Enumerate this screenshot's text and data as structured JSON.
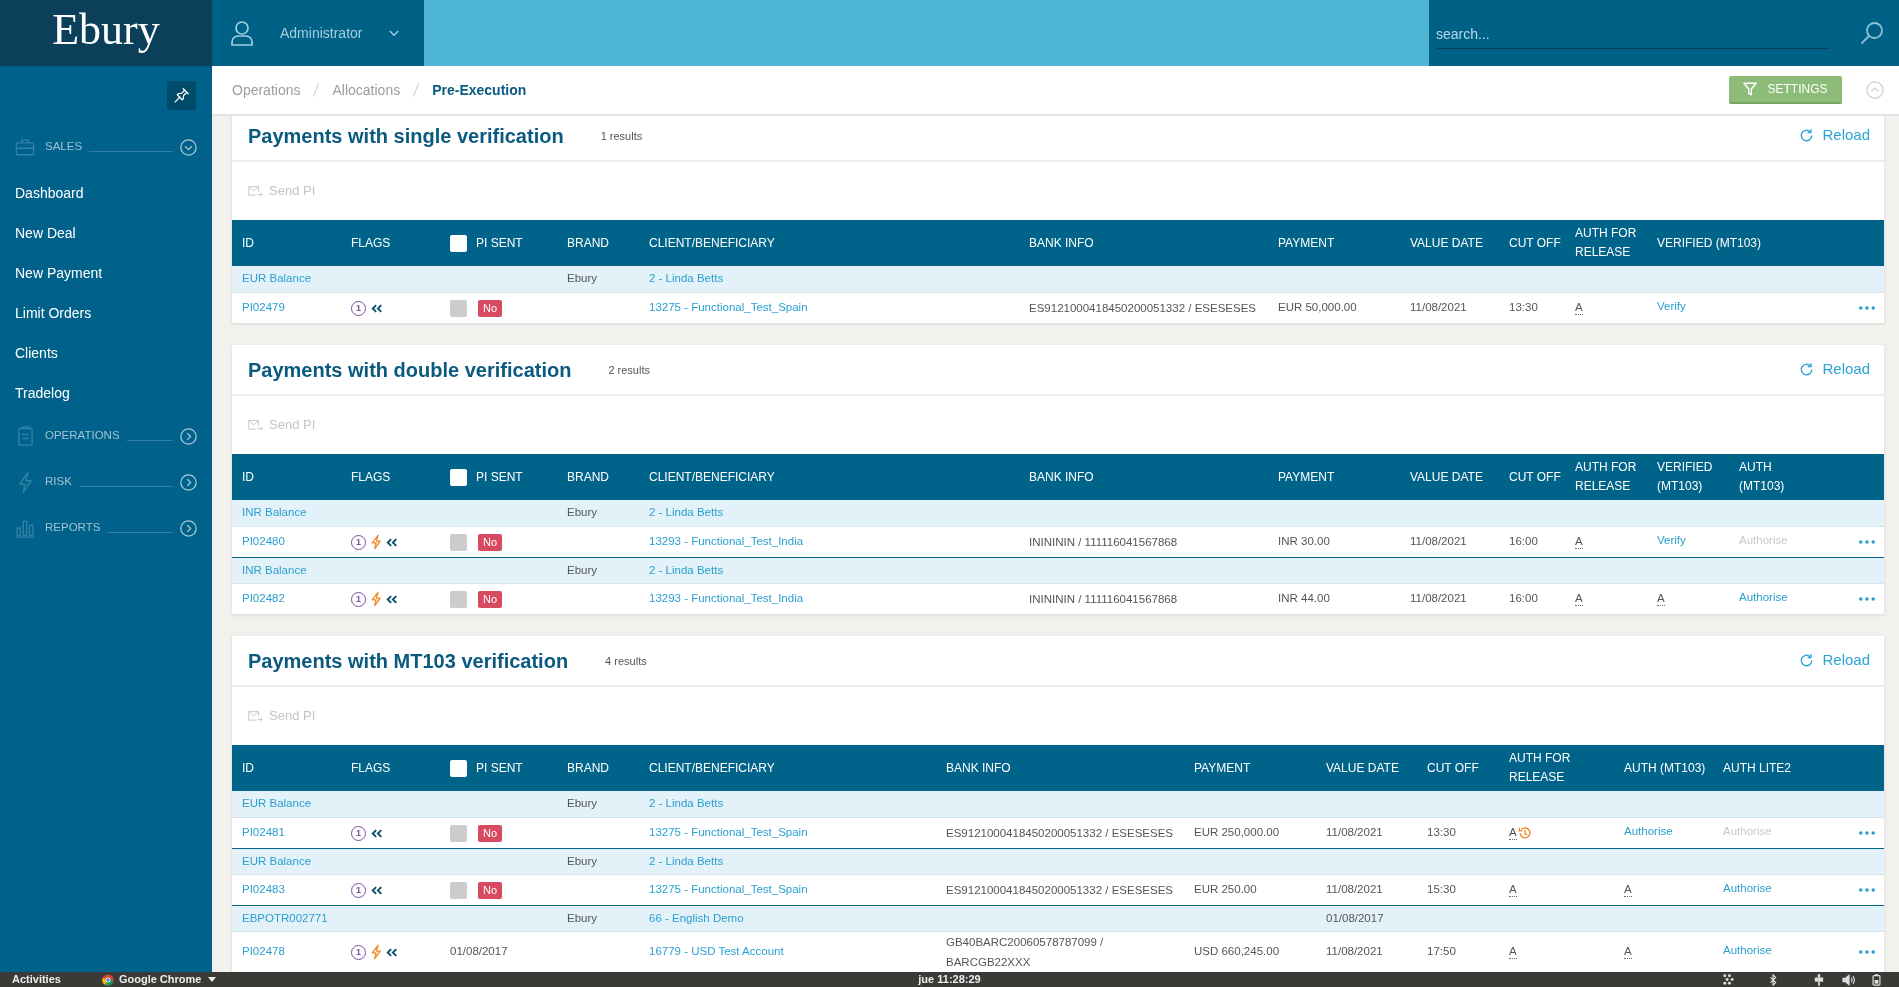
{
  "header": {
    "logo": "Ebury",
    "user_menu": {
      "label": "Administrator"
    },
    "search": {
      "placeholder": "search..."
    }
  },
  "sidebar": {
    "items": [
      {
        "kind": "section",
        "label": "SALES",
        "expanded": true
      },
      {
        "kind": "link",
        "label": "Dashboard"
      },
      {
        "kind": "link",
        "label": "New Deal"
      },
      {
        "kind": "link",
        "label": "New Payment"
      },
      {
        "kind": "link",
        "label": "Limit Orders"
      },
      {
        "kind": "link",
        "label": "Clients"
      },
      {
        "kind": "link",
        "label": "Tradelog"
      },
      {
        "kind": "section",
        "label": "OPERATIONS",
        "expanded": false
      },
      {
        "kind": "section",
        "label": "RISK",
        "expanded": false
      },
      {
        "kind": "section",
        "label": "REPORTS",
        "expanded": false
      }
    ]
  },
  "breadcrumb": [
    {
      "label": "Operations",
      "current": false
    },
    {
      "label": "Allocations",
      "current": false
    },
    {
      "label": "Pre-Execution",
      "current": true
    }
  ],
  "settings_button": {
    "label": "SETTINGS"
  },
  "panels": [
    {
      "title": "Payments with single verification",
      "count": "1 results",
      "reload": "Reload",
      "send_pi": {
        "label": "Send PI",
        "disabled": true
      },
      "table": {
        "columns": [
          {
            "label": "ID"
          },
          {
            "label": "FLAGS"
          },
          {
            "label": "PI SENT",
            "checkbox": {
              "checked": false
            }
          },
          {
            "label": "BRAND"
          },
          {
            "label": "CLIENT/BENEFICIARY"
          },
          {
            "label": "BANK INFO"
          },
          {
            "label": "PAYMENT"
          },
          {
            "label": "VALUE DATE"
          },
          {
            "label": "CUT OFF"
          },
          {
            "label": "AUTH FOR RELEASE"
          },
          {
            "label": "VERIFIED (MT103)"
          }
        ],
        "groups": [
          {
            "account": "EUR Balance",
            "brand": "Ebury",
            "client": "2 - Linda Betts",
            "payment": {
              "id": "PI02479",
              "flags": [
                {
                  "kind": "number",
                  "text": "1"
                },
                {
                  "kind": "chevrons"
                }
              ],
              "pi_sent": {
                "kind": "status",
                "checked": false,
                "disabled": true,
                "label": "No"
              },
              "beneficiary": "13275 - Functional_Test_Spain",
              "bank_info": "ES9121000418450200051332 / ESESESES",
              "amount": "EUR 50,000.00",
              "value_date": "11/08/2021",
              "cut_off": "13:30",
              "auth": [
                {
                  "kind": "initial",
                  "text": "A",
                  "pending": false
                },
                {
                  "kind": "action",
                  "text": "Verify",
                  "disabled": false
                }
              ]
            }
          }
        ]
      }
    },
    {
      "title": "Payments with double verification",
      "count": "2 results",
      "reload": "Reload",
      "send_pi": {
        "label": "Send PI",
        "disabled": true
      },
      "table": {
        "columns": [
          {
            "label": "ID"
          },
          {
            "label": "FLAGS"
          },
          {
            "label": "PI SENT",
            "checkbox": {
              "checked": false
            }
          },
          {
            "label": "BRAND"
          },
          {
            "label": "CLIENT/BENEFICIARY"
          },
          {
            "label": "BANK INFO"
          },
          {
            "label": "PAYMENT"
          },
          {
            "label": "VALUE DATE"
          },
          {
            "label": "CUT OFF"
          },
          {
            "label": "AUTH FOR RELEASE"
          },
          {
            "label": "VERIFIED (MT103)"
          },
          {
            "label": "AUTH (MT103)"
          }
        ],
        "groups": [
          {
            "account": "INR Balance",
            "brand": "Ebury",
            "client": "2 - Linda Betts",
            "payment": {
              "id": "PI02480",
              "flags": [
                {
                  "kind": "number",
                  "text": "1"
                },
                {
                  "kind": "bolt"
                },
                {
                  "kind": "chevrons"
                }
              ],
              "pi_sent": {
                "kind": "status",
                "checked": false,
                "disabled": true,
                "label": "No"
              },
              "beneficiary": "13293 - Functional_Test_India",
              "bank_info": "ININININ / 111116041567868",
              "amount": "INR 30.00",
              "value_date": "11/08/2021",
              "cut_off": "16:00",
              "auth": [
                {
                  "kind": "initial",
                  "text": "A",
                  "pending": false
                },
                {
                  "kind": "action",
                  "text": "Verify",
                  "disabled": false
                },
                {
                  "kind": "action",
                  "text": "Authorise",
                  "disabled": true
                }
              ]
            }
          },
          {
            "account": "INR Balance",
            "brand": "Ebury",
            "client": "2 - Linda Betts",
            "payment": {
              "id": "PI02482",
              "flags": [
                {
                  "kind": "number",
                  "text": "1"
                },
                {
                  "kind": "bolt"
                },
                {
                  "kind": "chevrons"
                }
              ],
              "pi_sent": {
                "kind": "status",
                "checked": false,
                "disabled": true,
                "label": "No"
              },
              "beneficiary": "13293 - Functional_Test_India",
              "bank_info": "ININININ / 111116041567868",
              "amount": "INR 44.00",
              "value_date": "11/08/2021",
              "cut_off": "16:00",
              "auth": [
                {
                  "kind": "initial",
                  "text": "A",
                  "pending": false
                },
                {
                  "kind": "initial",
                  "text": "A",
                  "pending": false
                },
                {
                  "kind": "action",
                  "text": "Authorise",
                  "disabled": false
                }
              ]
            }
          }
        ]
      }
    },
    {
      "title": "Payments with MT103 verification",
      "count": "4 results",
      "reload": "Reload",
      "send_pi": {
        "label": "Send PI",
        "disabled": true
      },
      "table": {
        "columns": [
          {
            "label": "ID"
          },
          {
            "label": "FLAGS"
          },
          {
            "label": "PI SENT",
            "checkbox": {
              "checked": false
            }
          },
          {
            "label": "BRAND"
          },
          {
            "label": "CLIENT/BENEFICIARY"
          },
          {
            "label": "BANK INFO"
          },
          {
            "label": "PAYMENT"
          },
          {
            "label": "VALUE DATE"
          },
          {
            "label": "CUT OFF"
          },
          {
            "label": "AUTH FOR RELEASE"
          },
          {
            "label": "AUTH (MT103)"
          },
          {
            "label": "AUTH LITE2"
          }
        ],
        "groups": [
          {
            "account": "EUR Balance",
            "brand": "Ebury",
            "client": "2 - Linda Betts",
            "payment": {
              "id": "PI02481",
              "flags": [
                {
                  "kind": "number",
                  "text": "1"
                },
                {
                  "kind": "chevrons"
                }
              ],
              "pi_sent": {
                "kind": "status",
                "checked": false,
                "disabled": true,
                "label": "No"
              },
              "beneficiary": "13275 - Functional_Test_Spain",
              "bank_info": "ES9121000418450200051332 / ESESESES",
              "amount": "EUR 250,000.00",
              "value_date": "11/08/2021",
              "cut_off": "13:30",
              "auth": [
                {
                  "kind": "initial",
                  "text": "A",
                  "pending": true
                },
                {
                  "kind": "action",
                  "text": "Authorise",
                  "disabled": false
                },
                {
                  "kind": "action",
                  "text": "Authorise",
                  "disabled": true
                }
              ]
            }
          },
          {
            "account": "EUR Balance",
            "brand": "Ebury",
            "client": "2 - Linda Betts",
            "payment": {
              "id": "PI02483",
              "flags": [
                {
                  "kind": "number",
                  "text": "1"
                },
                {
                  "kind": "chevrons"
                }
              ],
              "pi_sent": {
                "kind": "status",
                "checked": false,
                "disabled": true,
                "label": "No"
              },
              "beneficiary": "13275 - Functional_Test_Spain",
              "bank_info": "ES9121000418450200051332 / ESESESES",
              "amount": "EUR 250.00",
              "value_date": "11/08/2021",
              "cut_off": "15:30",
              "auth": [
                {
                  "kind": "initial",
                  "text": "A",
                  "pending": false
                },
                {
                  "kind": "initial",
                  "text": "A",
                  "pending": false
                },
                {
                  "kind": "action",
                  "text": "Authorise",
                  "disabled": false
                }
              ]
            }
          },
          {
            "account": "EBPOTR002771",
            "brand": "Ebury",
            "client": "66 - English Demo",
            "value_date": "01/08/2017",
            "payment": {
              "id": "PI02478",
              "flags": [
                {
                  "kind": "number",
                  "text": "1"
                },
                {
                  "kind": "bolt"
                },
                {
                  "kind": "chevrons"
                }
              ],
              "pi_sent": {
                "kind": "date",
                "text": "01/08/2017"
              },
              "beneficiary": "16779 - USD Test Account",
              "bank_info": "GB40BARC20060578787099 / BARCGB22XXX",
              "amount": "USD 660,245.00",
              "value_date": "11/08/2021",
              "cut_off": "17:50",
              "auth": [
                {
                  "kind": "initial",
                  "text": "A",
                  "pending": false
                },
                {
                  "kind": "initial",
                  "text": "A",
                  "pending": false
                },
                {
                  "kind": "action",
                  "text": "Authorise",
                  "disabled": false
                }
              ]
            }
          }
        ]
      }
    }
  ],
  "taskbar": {
    "activities": "Activities",
    "app": "Google Chrome",
    "clock": "jue 11:28:29"
  }
}
